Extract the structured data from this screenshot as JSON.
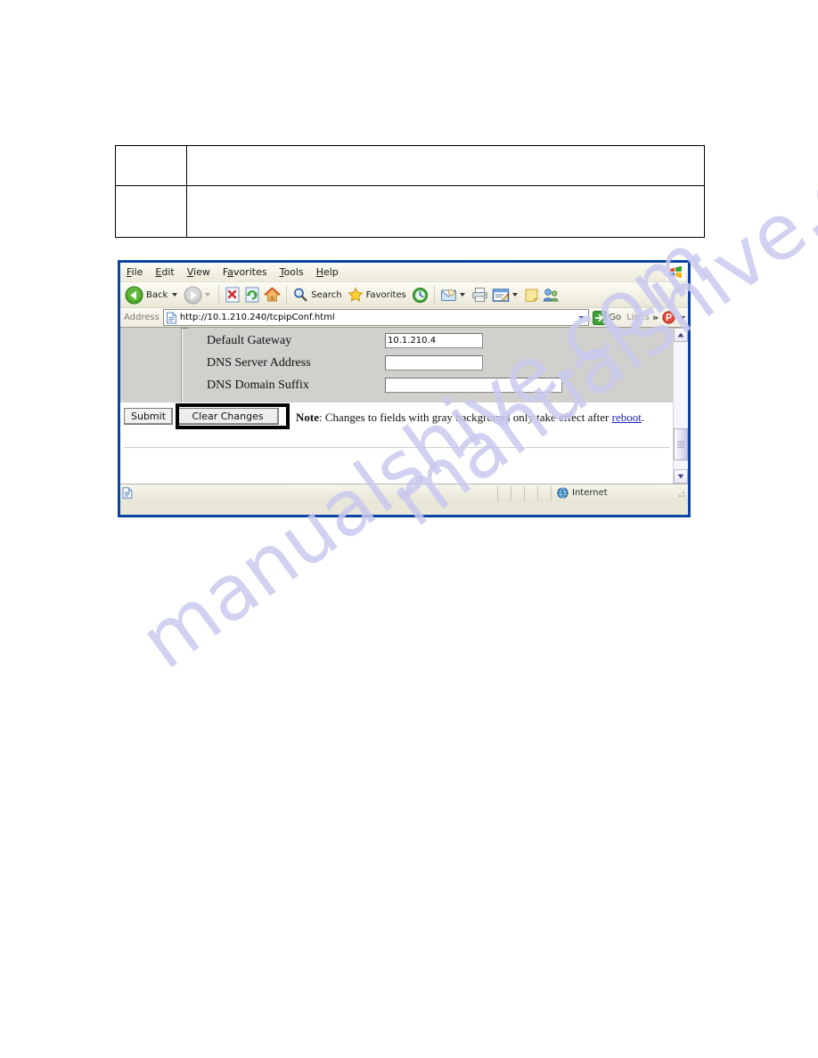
{
  "watermark": {
    "line1": "manualshive.com",
    "line2": "manualshive.com"
  },
  "doc_table": {
    "rows": [
      {
        "cells": [
          "",
          ""
        ]
      },
      {
        "cells": [
          "",
          ""
        ]
      }
    ]
  },
  "browser": {
    "menu": [
      {
        "label": "File",
        "accel": "F"
      },
      {
        "label": "Edit",
        "accel": "E"
      },
      {
        "label": "View",
        "accel": "V"
      },
      {
        "label": "Favorites",
        "accel": "a"
      },
      {
        "label": "Tools",
        "accel": "T"
      },
      {
        "label": "Help",
        "accel": "H"
      }
    ],
    "menu_logo_icon": "windows-flag-icon",
    "toolbar": {
      "back_label": "Back",
      "back_icon": "back-arrow-icon",
      "forward_icon": "forward-arrow-icon",
      "stop_icon": "stop-icon",
      "refresh_icon": "refresh-icon",
      "home_icon": "home-icon",
      "search_label": "Search",
      "search_icon": "magnifier-icon",
      "favorites_label": "Favorites",
      "favorites_icon": "star-icon",
      "history_icon": "history-icon",
      "mail_icon": "mail-icon",
      "print_icon": "printer-icon",
      "edit_icon": "edit-page-icon",
      "notes_icon": "note-icon",
      "messenger_icon": "messenger-icon"
    },
    "address": {
      "label": "Address",
      "page_icon": "page-icon",
      "url": "http://10.1.210.240/tcpipConf.html",
      "dropdown_icon": "chevron-down-icon",
      "go_label": "Go",
      "go_icon": "go-arrow-icon",
      "links_label": "Links",
      "overflow_icon": "double-chevron-icon",
      "acrobat_icon": "acrobat-icon"
    },
    "page": {
      "fields": [
        {
          "label": "Default Gateway",
          "value": "10.1.210.4",
          "width": "short"
        },
        {
          "label": "DNS Server Address",
          "value": "",
          "width": "short"
        },
        {
          "label": "DNS Domain Suffix",
          "value": "",
          "width": "long"
        }
      ],
      "buttons": {
        "submit": "Submit",
        "clear": "Clear Changes"
      },
      "note": {
        "prefix": "Note",
        "separator": ": ",
        "text": "Changes to fields with gray background only take effect after ",
        "link": "reboot",
        "suffix": "."
      },
      "scrollbar": {
        "up_icon": "scroll-up-icon",
        "down_icon": "scroll-down-icon",
        "thumb": "scroll-thumb"
      }
    },
    "statusbar": {
      "doc_icon": "page-icon",
      "zone_label": "Internet",
      "zone_icon": "globe-icon"
    }
  },
  "colors": {
    "frame_blue": "#0b44a6",
    "form_gray": "#d2d0cd",
    "link_blue": "#2222bb",
    "highlight_black": "#000000"
  }
}
